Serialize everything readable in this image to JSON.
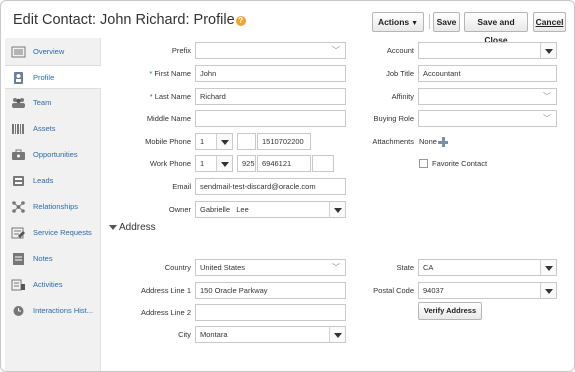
{
  "header": {
    "title_prefix": "Edit Contact: John Richard: ",
    "title_page": "Profile",
    "help_glyph": "?",
    "actions_label": "Actions",
    "save_label": "Save",
    "save_close_label": "Save and Close",
    "cancel_label": "Cancel"
  },
  "sidebar": {
    "items": [
      {
        "label": "Overview",
        "icon": "overview-icon"
      },
      {
        "label": "Profile",
        "icon": "profile-icon"
      },
      {
        "label": "Team",
        "icon": "team-icon"
      },
      {
        "label": "Assets",
        "icon": "assets-icon"
      },
      {
        "label": "Opportunities",
        "icon": "opportunities-icon"
      },
      {
        "label": "Leads",
        "icon": "leads-icon"
      },
      {
        "label": "Relationships",
        "icon": "relationships-icon"
      },
      {
        "label": "Service Requests",
        "icon": "service-requests-icon"
      },
      {
        "label": "Notes",
        "icon": "notes-icon"
      },
      {
        "label": "Activities",
        "icon": "activities-icon"
      },
      {
        "label": "Interactions Hist...",
        "icon": "interactions-icon"
      }
    ],
    "active": "Profile"
  },
  "form": {
    "prefix": {
      "label": "Prefix",
      "value": ""
    },
    "first_name": {
      "label": "First Name",
      "value": "John"
    },
    "last_name": {
      "label": "Last Name",
      "value": "Richard"
    },
    "middle_name": {
      "label": "Middle Name",
      "value": ""
    },
    "mobile_phone": {
      "label": "Mobile Phone",
      "country": "1",
      "area": "",
      "number": "1510702200"
    },
    "work_phone": {
      "label": "Work Phone",
      "country": "1",
      "area": "925",
      "number": "6946121",
      "ext": ""
    },
    "email": {
      "label": "Email",
      "value": "sendmail-test-discard@oracle.com"
    },
    "owner": {
      "label": "Owner",
      "value": "Gabrielle   Lee"
    },
    "account": {
      "label": "Account",
      "value": ""
    },
    "job_title": {
      "label": "Job Title",
      "value": "Accountant"
    },
    "affinity": {
      "label": "Affinity",
      "value": ""
    },
    "buying_role": {
      "label": "Buying Role",
      "value": ""
    },
    "attachments": {
      "label": "Attachments",
      "value": "None"
    },
    "favorite_contact": {
      "label": "Favorite Contact",
      "checked": false
    }
  },
  "address": {
    "section_title": "Address",
    "country": {
      "label": "Country",
      "value": "United States"
    },
    "line1": {
      "label": "Address Line 1",
      "value": "150 Oracle Parkway"
    },
    "line2": {
      "label": "Address Line 2",
      "value": ""
    },
    "city": {
      "label": "City",
      "value": "Montara"
    },
    "state": {
      "label": "State",
      "value": "CA"
    },
    "postal_code": {
      "label": "Postal Code",
      "value": "94037"
    },
    "verify_label": "Verify Address"
  }
}
